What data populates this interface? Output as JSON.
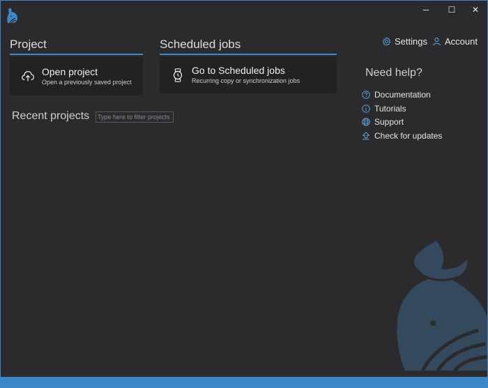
{
  "window": {
    "minimize_glyph": "─",
    "maximize_glyph": "☐",
    "close_glyph": "✕"
  },
  "top_links": {
    "settings_label": "Settings",
    "account_label": "Account"
  },
  "project": {
    "header": "Project",
    "open_title": "Open project",
    "open_subtitle": "Open a previously saved project"
  },
  "scheduled": {
    "header": "Scheduled jobs",
    "go_title": "Go to Scheduled jobs",
    "go_subtitle": "Recurring copy or synchronization jobs"
  },
  "recent": {
    "title": "Recent projects",
    "filter_placeholder": "Type here to filter projects"
  },
  "help": {
    "title": "Need help?",
    "items": [
      {
        "label": "Documentation",
        "icon": "question-circle-icon"
      },
      {
        "label": "Tutorials",
        "icon": "info-circle-icon"
      },
      {
        "label": "Support",
        "icon": "globe-icon"
      },
      {
        "label": "Check for updates",
        "icon": "upload-icon"
      }
    ]
  },
  "colors": {
    "background": "#2b2b2e",
    "card": "#222224",
    "accent": "#3c88c8",
    "watermark": "#34495d"
  }
}
